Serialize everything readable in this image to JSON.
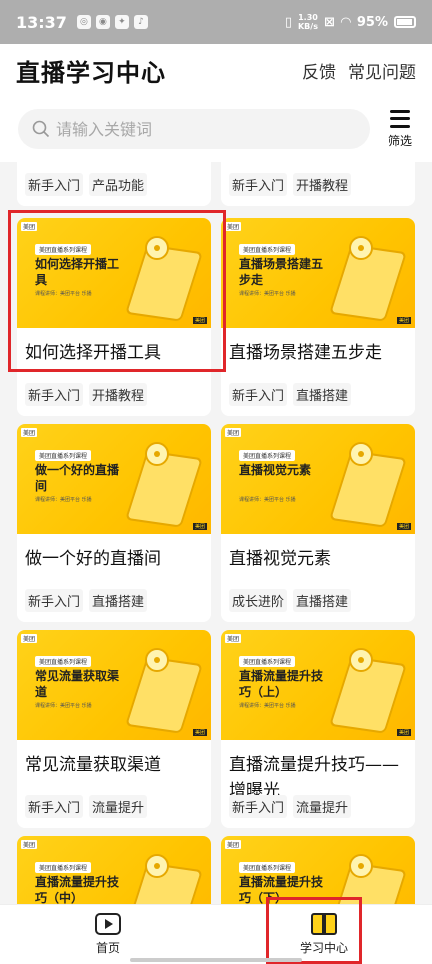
{
  "status_bar": {
    "time": "13:37",
    "speed_top": "1.30",
    "speed_bottom": "KB/s",
    "battery": "95%"
  },
  "header": {
    "title": "直播学习中心",
    "feedback": "反馈",
    "faq": "常见问题"
  },
  "search": {
    "placeholder": "请输入关键词",
    "filter_label": "筛选"
  },
  "cards": [
    {
      "title": "",
      "thumb_title": "",
      "tags": [
        "新手入门",
        "产品功能"
      ]
    },
    {
      "title": "",
      "thumb_title": "",
      "tags": [
        "新手入门",
        "开播教程"
      ]
    },
    {
      "title": "如何选择开播工具",
      "thumb_title": "如何选择开播工具",
      "tags": [
        "新手入门",
        "开播教程"
      ]
    },
    {
      "title": "直播场景搭建五步走",
      "thumb_title": "直播场景搭建五步走",
      "tags": [
        "新手入门",
        "直播搭建"
      ]
    },
    {
      "title": "做一个好的直播间",
      "thumb_title": "做一个好的直播间",
      "tags": [
        "新手入门",
        "直播搭建"
      ]
    },
    {
      "title": "直播视觉元素",
      "thumb_title": "直播视觉元素",
      "tags": [
        "成长进阶",
        "直播搭建"
      ]
    },
    {
      "title": "常见流量获取渠道",
      "thumb_title": "常见流量获取渠道",
      "tags": [
        "新手入门",
        "流量提升"
      ]
    },
    {
      "title": "直播流量提升技巧——增曝光",
      "thumb_title": "直播流量提升技巧（上）",
      "tags": [
        "新手入门",
        "流量提升"
      ]
    },
    {
      "title": "",
      "thumb_title": "直播流量提升技巧（中）",
      "tags": []
    },
    {
      "title": "",
      "thumb_title": "直播流量提升技巧（下）",
      "tags": []
    }
  ],
  "thumb_common": {
    "brand": "美团",
    "series": "美团直播系列课程",
    "speaker": "课程讲师：美团平台 乐播",
    "logo2": "美团"
  },
  "bottom_nav": {
    "home": "首页",
    "learn": "学习中心"
  }
}
